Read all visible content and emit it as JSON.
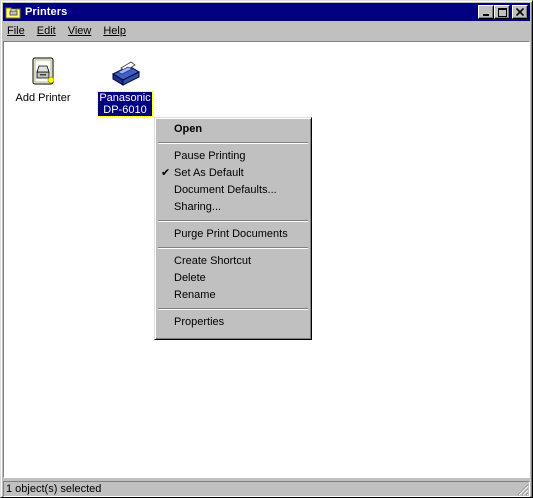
{
  "window": {
    "title": "Printers",
    "icon": "printers-folder-icon",
    "buttons": [
      "minimize",
      "maximize",
      "close"
    ]
  },
  "menubar": {
    "items": [
      {
        "label": "File"
      },
      {
        "label": "Edit"
      },
      {
        "label": "View"
      },
      {
        "label": "Help"
      }
    ]
  },
  "icons": [
    {
      "label": "Add Printer",
      "icon": "add-printer-icon",
      "selected": false
    },
    {
      "label_line1": "Panasonic",
      "label_line2": "DP-6010",
      "icon": "printer-icon",
      "selected": true
    }
  ],
  "context_menu": {
    "items": [
      {
        "label": "Open",
        "bold": true
      },
      {
        "label": "Pause Printing"
      },
      {
        "label": "Set As Default",
        "checked": true
      },
      {
        "label": "Document Defaults..."
      },
      {
        "label": "Sharing..."
      },
      {
        "label": "Purge Print Documents"
      },
      {
        "label": "Create Shortcut"
      },
      {
        "label": "Delete"
      },
      {
        "label": "Rename"
      },
      {
        "label": "Properties"
      }
    ]
  },
  "status": {
    "text": "1 object(s) selected"
  }
}
